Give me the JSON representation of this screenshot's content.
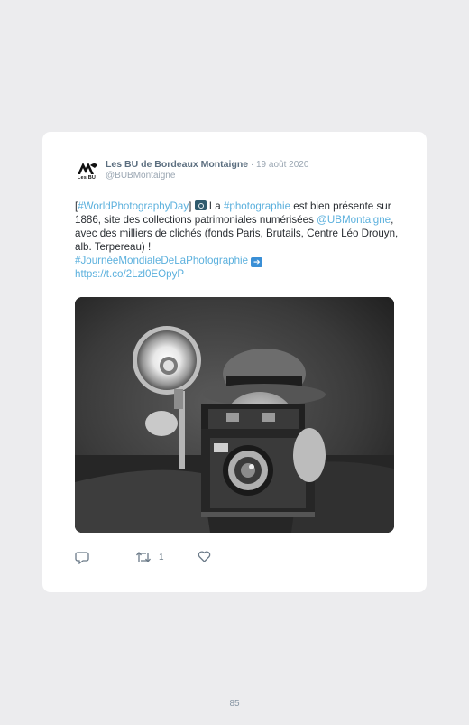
{
  "tweet": {
    "author_name": "Les BU de Bordeaux Montaigne",
    "date": " · 19 août 2020",
    "handle": "@BUBMontaigne",
    "avatar_text": "Les BU",
    "body": {
      "open_bracket": "[",
      "hashtag_world_photo_day": "#WorldPhotographyDay",
      "close_bracket": "]",
      "text_la": " La ",
      "hashtag_photographie": "#photographie",
      "text_1": " est bien présente sur 1886, site des collections patrimoniales numérisées ",
      "mention_ubmontaigne": "@UBMontaigne",
      "text_2": ", avec des milliers de clichés (fonds Paris, Brutails, Centre Léo Drouyn, alb. Terpereau) !",
      "hashtag_journee": "#JournéeMondialeDeLaPhotographie",
      "link": "https://t.co/2Lzl0EOpyP"
    },
    "retweet_count": "1"
  },
  "icons": {
    "avatar": "bu-logo-icon",
    "camera_emoji": "camera-emoji-icon",
    "arrow_emoji": "right-arrow-emoji-icon",
    "reply": "reply-icon",
    "retweet": "retweet-icon",
    "like": "heart-icon"
  },
  "colors": {
    "link": "#5bb0dd",
    "author": "#5b6e7f",
    "muted": "#9aa6b2"
  },
  "page_number": "85"
}
